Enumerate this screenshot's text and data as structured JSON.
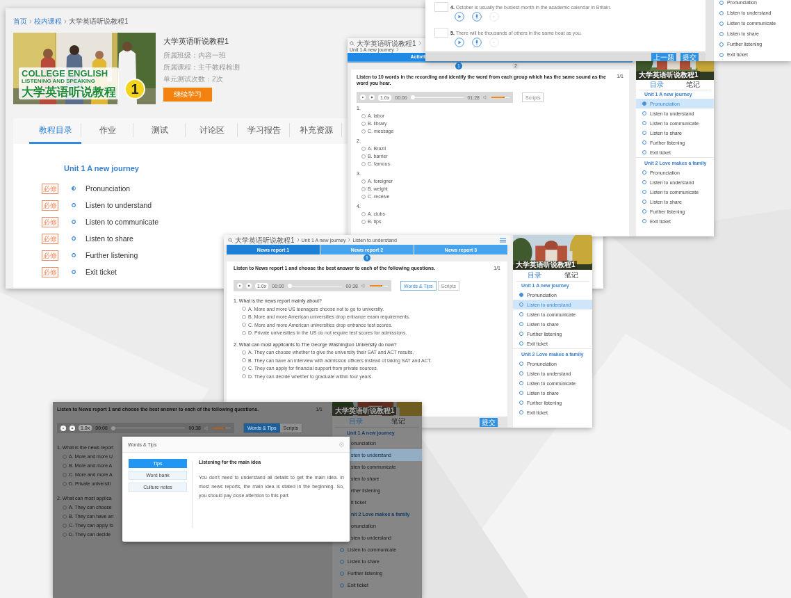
{
  "course_page": {
    "breadcrumb": [
      {
        "label": "首页",
        "kind": "link"
      },
      {
        "label": "校内课程",
        "kind": "link"
      },
      {
        "label": "大学英语听说教程1",
        "kind": "current"
      }
    ],
    "cover": {
      "lines": [
        "COLLEGE ENGLISH",
        "LISTENING AND SPEAKING"
      ],
      "chinese_title": "大学英语听说教程",
      "volume": "1"
    },
    "title": "大学英语听说教程1",
    "details": [
      "所属班级：内容一班",
      "所属课程：主干教程检测",
      "单元测试次数：2次"
    ],
    "continue_button": "继续学习",
    "tabs": [
      {
        "label": "教程目录",
        "selected": true
      },
      {
        "label": "作业",
        "selected": false
      },
      {
        "label": "测试",
        "selected": false
      },
      {
        "label": "讨论区",
        "selected": false
      },
      {
        "label": "学习报告",
        "selected": false
      },
      {
        "label": "补充资源",
        "selected": false
      }
    ],
    "unit_title": "Unit 1 A new journey",
    "lessons": [
      {
        "tag": "必修",
        "label": "Pronunciation",
        "started": true
      },
      {
        "tag": "必修",
        "label": "Listen to understand",
        "started": false
      },
      {
        "tag": "必修",
        "label": "Listen to communicate",
        "started": false
      },
      {
        "tag": "必修",
        "label": "Listen to share",
        "started": false
      },
      {
        "tag": "必修",
        "label": "Further listening",
        "started": false
      },
      {
        "tag": "必修",
        "label": "Exit ticket",
        "started": false
      }
    ]
  },
  "pronunciation_window": {
    "sentences": [
      "**4.** October is usually the busiest month in the academic calendar in Britain.",
      "**5.** There will be thousands of others in the same boat as you."
    ],
    "buttons": [
      "上一题",
      "提交"
    ],
    "sidebar_items": [
      "Pronunciation",
      "Listen to understand",
      "Listen to communicate",
      "Listen to share",
      "Further listening",
      "Exit ticket"
    ]
  },
  "activity_window": {
    "breadcrumb": [
      "大学英语听说教程1",
      "Unit 1 A new journey"
    ],
    "tab": "Activit",
    "steps": [
      {
        "label": "1",
        "selected": true
      },
      {
        "label": "2",
        "selected": false
      }
    ],
    "instruction": "Listen to 10 words in the recording and identify the word from each group which has the same sound as the word you hear.",
    "page": "1/1",
    "player": {
      "speed": "1.0x",
      "elapsed": "00:00",
      "duration": "01:28",
      "progress": {
        "level": 0
      },
      "volume": {
        "level": 0.65
      }
    },
    "scripts_button": "Scripts",
    "questions": [
      {
        "number": "1.",
        "options": [
          {
            "label": "A. labor",
            "selected": false
          },
          {
            "label": "B. library",
            "selected": false
          },
          {
            "label": "C. message",
            "selected": false
          }
        ]
      },
      {
        "number": "2.",
        "options": [
          {
            "label": "A. Brazil",
            "selected": false
          },
          {
            "label": "B. barrier",
            "selected": false
          },
          {
            "label": "C. famous",
            "selected": false
          }
        ]
      },
      {
        "number": "3.",
        "options": [
          {
            "label": "A. foreigner",
            "selected": false
          },
          {
            "label": "B. weight",
            "selected": false
          },
          {
            "label": "C. receive",
            "selected": false
          }
        ]
      },
      {
        "number": "4.",
        "options": [
          {
            "label": "A. clubs",
            "selected": false
          },
          {
            "label": "B. tips",
            "selected": false
          }
        ]
      }
    ],
    "sidebar": {
      "title": "大学英语听说教程1",
      "tabs": [
        {
          "label": "目录",
          "selected": true
        },
        {
          "label": "笔记",
          "selected": false
        }
      ],
      "units": [
        {
          "title": "Unit 1 A new journey",
          "items": [
            {
              "label": "Pronunciation",
              "selected": true,
              "started": true
            },
            {
              "label": "Listen to understand",
              "selected": false,
              "started": false
            },
            {
              "label": "Listen to communicate",
              "selected": false,
              "started": false
            },
            {
              "label": "Listen to share",
              "selected": false,
              "started": false
            },
            {
              "label": "Further listening",
              "selected": false,
              "started": false
            },
            {
              "label": "Exit ticket",
              "selected": false,
              "started": false
            }
          ]
        },
        {
          "title": "Unit 2 Love makes a family",
          "items": [
            {
              "label": "Pronunciation",
              "selected": false,
              "started": false
            },
            {
              "label": "Listen to understand",
              "selected": false,
              "started": false
            },
            {
              "label": "Listen to communicate",
              "selected": false,
              "started": false
            },
            {
              "label": "Listen to share",
              "selected": false,
              "started": false
            },
            {
              "label": "Further listening",
              "selected": false,
              "started": false
            },
            {
              "label": "Exit ticket",
              "selected": false,
              "started": false
            }
          ]
        }
      ]
    }
  },
  "news_window": {
    "breadcrumb": [
      "大学英语听说教程1",
      "Unit 1 A new journey",
      "Listen to understand"
    ],
    "tabs": [
      {
        "label": "News report 1",
        "selected": true
      },
      {
        "label": "News report 2",
        "selected": false
      },
      {
        "label": "News report 3",
        "selected": false
      }
    ],
    "step": "1",
    "instruction": "Listen to News report 1 and choose the best answer to each of the following questions.",
    "page": "1/1",
    "player": {
      "speed": "1.0x",
      "elapsed": "00:00",
      "duration": "00:38",
      "progress": {
        "level": 0
      },
      "volume": {
        "level": 0.6
      }
    },
    "toggles": [
      {
        "label": "Words & Tips",
        "disabled": false
      },
      {
        "label": "Scripts",
        "disabled": true
      }
    ],
    "questions": [
      {
        "text": "1. What is the news report mainly about?",
        "options": [
          {
            "label": "A. More and more US teenagers choose not to go to university.",
            "selected": false
          },
          {
            "label": "B. More and more American universities drop entrance exam requirements.",
            "selected": false
          },
          {
            "label": "C. More and more American universities drop entrance test scores.",
            "selected": false
          },
          {
            "label": "D. Private universities in the US do not require test scores for admissions.",
            "selected": false
          }
        ]
      },
      {
        "text": "2. What can most applicants to The George Washington University do now?",
        "options": [
          {
            "label": "A. They can choose whether to give the university their SAT and ACT results.",
            "selected": false
          },
          {
            "label": "B. They can have an interview with admission officers instead of taking SAT and ACT.",
            "selected": false
          },
          {
            "label": "C. They can apply for financial support from private sources.",
            "selected": false
          },
          {
            "label": "D. They can decide whether to graduate within four years.",
            "selected": false
          }
        ]
      }
    ],
    "submit": "提交",
    "sidebar": {
      "title": "大学英语听说教程1",
      "tabs": [
        {
          "label": "目录",
          "selected": true
        },
        {
          "label": "笔记",
          "selected": false
        }
      ],
      "units": [
        {
          "title": "Unit 1 A new journey",
          "items": [
            {
              "label": "Pronunciation",
              "selected": false,
              "started": true
            },
            {
              "label": "Listen to understand",
              "selected": true,
              "started": false
            },
            {
              "label": "Listen to communicate",
              "selected": false,
              "started": false
            },
            {
              "label": "Listen to share",
              "selected": false,
              "started": false
            },
            {
              "label": "Further listening",
              "selected": false,
              "started": false
            },
            {
              "label": "Exit ticket",
              "selected": false,
              "started": false
            }
          ]
        },
        {
          "title": "Unit 2 Love makes a family",
          "items": [
            {
              "label": "Pronunciation",
              "selected": false,
              "started": false
            },
            {
              "label": "Listen to understand",
              "selected": false,
              "started": false
            },
            {
              "label": "Listen to communicate",
              "selected": false,
              "started": false
            },
            {
              "label": "Listen to share",
              "selected": false,
              "started": false
            },
            {
              "label": "Further listening",
              "selected": false,
              "started": false
            },
            {
              "label": "Exit ticket",
              "selected": false,
              "started": false
            }
          ]
        }
      ]
    }
  },
  "tips_window": {
    "instruction": "Listen to News report 1 and choose the best answer to each of the following questions.",
    "page": "1/1",
    "player": {
      "speed": "1.0x",
      "elapsed": "00:00",
      "duration": "00:38",
      "progress": {
        "level": 0
      },
      "volume": {
        "level": 0.6
      }
    },
    "toggles": [
      {
        "label": "Words & Tips",
        "selected": true
      },
      {
        "label": "Scripts",
        "selected": false
      }
    ],
    "questions": [
      {
        "text": "1. What is the news report",
        "options": [
          {
            "label": "A. More and more U",
            "selected": false
          },
          {
            "label": "B. More and more A",
            "selected": false
          },
          {
            "label": "C. More and more A",
            "selected": false
          },
          {
            "label": "D. Private universiti",
            "selected": false
          }
        ]
      },
      {
        "text": "2. What can most applica",
        "options": [
          {
            "label": "A. They can choose",
            "selected": false
          },
          {
            "label": "B. They can have an",
            "selected": false
          },
          {
            "label": "C. They can apply fo",
            "selected": false
          },
          {
            "label": "D. They can decide",
            "selected": false
          }
        ]
      }
    ],
    "sidebar": {
      "title": "大学英语听说教程1",
      "tabs": [
        {
          "label": "目录",
          "selected": true
        },
        {
          "label": "笔记",
          "selected": false
        }
      ],
      "entries": [
        {
          "kind": "heading",
          "label": "Unit 1 A new journey"
        },
        {
          "kind": "clipped_item",
          "label": "onunciation",
          "selected": false
        },
        {
          "kind": "clipped_item",
          "label": "sten to understand",
          "selected": true
        },
        {
          "kind": "clipped_item",
          "label": "sten to communicate",
          "selected": false
        },
        {
          "kind": "clipped_item",
          "label": "sten to share",
          "selected": false
        },
        {
          "kind": "clipped_item",
          "label": "rther listening",
          "selected": false
        },
        {
          "kind": "clipped_item",
          "label": "it ticket",
          "selected": false
        },
        {
          "kind": "clipped_heading",
          "label": "nit 2 Love makes a family"
        },
        {
          "kind": "clipped_item",
          "label": "onunciation",
          "selected": false
        },
        {
          "kind": "clipped_item",
          "label": "sten to understand",
          "selected": false
        },
        {
          "kind": "item",
          "label": "Listen to communicate",
          "selected": false
        },
        {
          "kind": "item",
          "label": "Listen to share",
          "selected": false
        },
        {
          "kind": "item",
          "label": "Further listening",
          "selected": false
        },
        {
          "kind": "item",
          "label": "Exit ticket",
          "selected": false
        }
      ]
    },
    "dialog": {
      "title": "Words & Tips",
      "tabs": [
        {
          "label": "Tips",
          "selected": true
        },
        {
          "label": "Word bank",
          "selected": false
        },
        {
          "label": "Culture notes",
          "selected": false
        }
      ],
      "heading": "Listening for the main idea",
      "body": "You don't need to understand all details to get the main idea. In most news reports, the main idea is stated in the beginning. So, you should pay close attention to this part."
    }
  }
}
